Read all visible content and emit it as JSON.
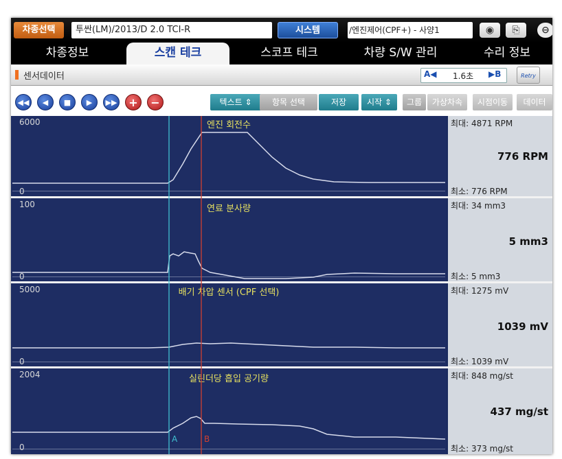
{
  "topbar": {
    "vehicle_button": "차종선택",
    "vehicle_value": "투싼(LM)/2013/D 2.0 TCI-R",
    "system_button": "시스템",
    "system_value": "/엔진제어(CPF+) - 사양1",
    "icons": [
      "camera-icon",
      "print-icon",
      "exit-icon"
    ]
  },
  "tabs": [
    "차종정보",
    "스캔 테크",
    "스코프 테크",
    "차량 S/W 관리",
    "수리 정보"
  ],
  "active_tab": "스캔 테크",
  "sensor_bar": {
    "title": "센서데이터",
    "marker_a": "A◀",
    "interval": "1.6초",
    "marker_b": "▶B",
    "retry": "Retry"
  },
  "toolbar": {
    "play_icons": [
      "rewind-icon",
      "prev-icon",
      "stop-icon",
      "play-icon",
      "fast-forward-icon",
      "zoom-in-icon",
      "zoom-out-icon"
    ],
    "text_btn": "텍스트",
    "select_items_btn": "항목 선택",
    "save_btn": "저장",
    "start_btn": "시작",
    "group_btn": "그룹",
    "virtual_speed_btn": "가상차속",
    "shift_btn": "시점이동",
    "data_btn": "데이터"
  },
  "plots": [
    {
      "title": "엔진 회전수",
      "axis_max": "6000",
      "axis_min": "0",
      "max": "최대:  4871 RPM",
      "current": "776 RPM",
      "min": "최소:   776 RPM"
    },
    {
      "title": "연료 분사량",
      "axis_max": "100",
      "axis_min": "0",
      "max": "최대:   34 mm3",
      "current": "5 mm3",
      "min": "최소:     5 mm3"
    },
    {
      "title": "배기 차압 센서 (CPF 선택)",
      "axis_max": "5000",
      "axis_min": "0",
      "max": "최대:  1275 mV",
      "current": "1039 mV",
      "min": "최소:  1039 mV"
    },
    {
      "title": "실린더당 흡입 공기량",
      "axis_max": "2004",
      "axis_min": "0",
      "max": "최대:   848 mg/st",
      "current": "437 mg/st",
      "min": "최소:   373 mg/st"
    }
  ],
  "cursor_labels": {
    "a": "A",
    "b": "B"
  },
  "colors": {
    "plot_bg": "#1e2d63",
    "trace": "#d8dcec",
    "cursor_a": "#40c0d0",
    "cursor_b": "#d04030",
    "title": "#e6e060"
  }
}
